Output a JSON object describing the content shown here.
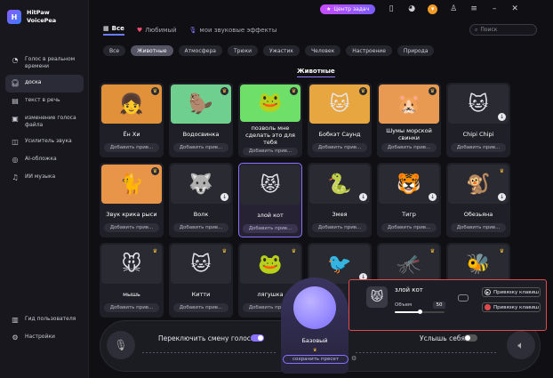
{
  "app": {
    "brand_line1": "HitPaw",
    "brand_line2": "VoicePea"
  },
  "sidebar": {
    "items": [
      {
        "label": "Голос в реальном времени",
        "icon": "realtime-icon",
        "active": false
      },
      {
        "label": "доска",
        "icon": "headphones-icon",
        "active": true
      },
      {
        "label": "текст в речь",
        "icon": "tts-icon",
        "active": false
      },
      {
        "label": "изменение голоса файла",
        "icon": "file-voice-icon",
        "active": false
      },
      {
        "label": "Усилитель звука",
        "icon": "amplifier-icon",
        "active": false
      },
      {
        "label": "AI-обложка",
        "icon": "ai-cover-icon",
        "active": false
      },
      {
        "label": "ИИ музыка",
        "icon": "music-icon",
        "active": false
      }
    ],
    "bottom_items": [
      {
        "label": "Гид пользователя",
        "icon": "guide-icon"
      },
      {
        "label": "Настройки",
        "icon": "settings-icon"
      }
    ]
  },
  "topbar": {
    "task_center": "Центр задач"
  },
  "tabs": [
    {
      "label": "Все",
      "active": true
    },
    {
      "label": "Любимый",
      "active": false
    },
    {
      "label": "мои звуковые эффекты",
      "active": false
    }
  ],
  "search": {
    "placeholder": "Поиск"
  },
  "chips": [
    "Все",
    "Животные",
    "Атмосфера",
    "Трюки",
    "Ужастик",
    "Человек",
    "Настроение",
    "Природа"
  ],
  "active_chip": "Животные",
  "section_title": "Животные",
  "add_label": "Добавить прив...",
  "cards": [
    {
      "name": "Ён Хи",
      "face": "👧",
      "bg": "#e0913a",
      "crown": true
    },
    {
      "name": "Водосвинка",
      "face": "🦫",
      "bg": "#6fcf8f",
      "crown": true
    },
    {
      "name": "позволь мне сделать это для тебя",
      "face": "🐸",
      "bg": "#6ee06a",
      "crown": true
    },
    {
      "name": "Бобкэт Саунд",
      "face": "🐱",
      "bg": "#e8a640",
      "crown": true
    },
    {
      "name": "Шумы морской свинки",
      "face": "🐹",
      "bg": "#e89a52",
      "crown": true
    },
    {
      "name": "Chipi Chipi",
      "face": "🐱",
      "bg": "#2a2a33",
      "crown": false,
      "download": true
    },
    {
      "name": "Звук крика рыси",
      "face": "🐈",
      "bg": "#e8954a",
      "crown": true
    },
    {
      "name": "Волк",
      "face": "🐺",
      "bg": "#2a2a33",
      "crown": false,
      "download": true
    },
    {
      "name": "злой кот",
      "face": "😾",
      "bg": "#2a2a33",
      "crown": false,
      "selected": true
    },
    {
      "name": "Змея",
      "face": "🐍",
      "bg": "#2a2a33",
      "crown": false,
      "download": true
    },
    {
      "name": "Тигр",
      "face": "🐯",
      "bg": "#2a2a33",
      "crown": false,
      "download": true
    },
    {
      "name": "Обезьяна",
      "face": "🐒",
      "bg": "#2a2a33",
      "crown": true,
      "download": true
    },
    {
      "name": "мышь",
      "face": "🐭",
      "bg": "#2a2a33",
      "crown": true
    },
    {
      "name": "Китти",
      "face": "🐱",
      "bg": "#2a2a33",
      "crown": true
    },
    {
      "name": "лягушка",
      "face": "🐸",
      "bg": "#2a2a33",
      "crown": true
    },
    {
      "name": "",
      "face": "🐦",
      "bg": "#2a2a33",
      "crown": false,
      "download": true
    },
    {
      "name": "",
      "face": "🦟",
      "bg": "#2a2a33",
      "crown": true
    },
    {
      "name": "",
      "face": "🐝",
      "bg": "#2a2a33",
      "crown": true
    }
  ],
  "bottom": {
    "switch_label": "Переключить смену голоса",
    "hear_label": "Услышь себя",
    "center_label": "Базовый",
    "save_preset": "сохранить пресет"
  },
  "popup": {
    "name": "злой кот",
    "volume_label": "Объем",
    "volume_value": "50",
    "volume_fraction": 0.5,
    "hotkey1": "Привязку клавиш",
    "hotkey2": "Привязку клавиш"
  }
}
